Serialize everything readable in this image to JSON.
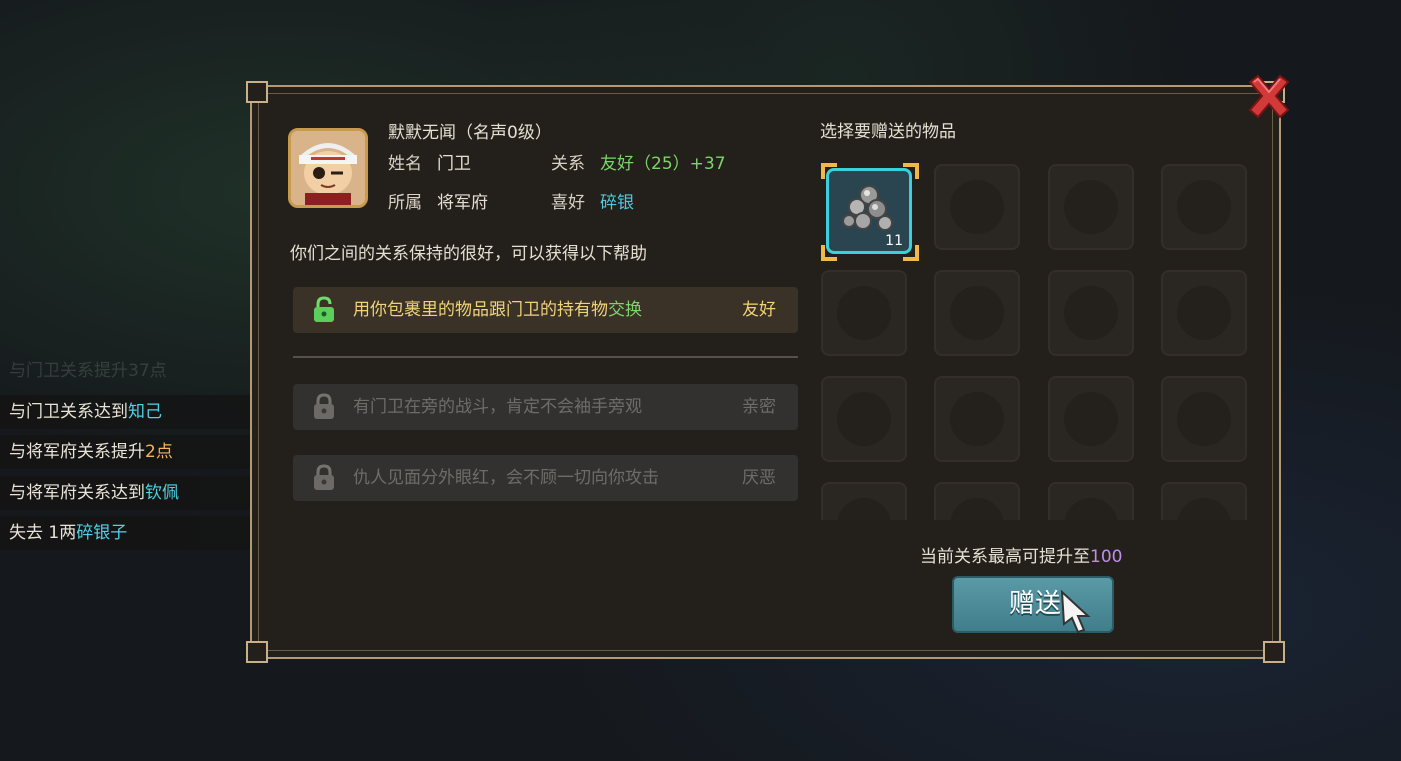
{
  "chat_log": [
    {
      "segments": [
        {
          "text": "与门卫关系提升37点",
          "color": ""
        }
      ],
      "faded": true
    },
    {
      "segments": [
        {
          "text": "与门卫关系达到",
          "color": ""
        },
        {
          "text": "知己",
          "color": "cyan"
        }
      ],
      "faded": false
    },
    {
      "segments": [
        {
          "text": "与将军府关系提升",
          "color": ""
        },
        {
          "text": "2点",
          "color": "orange"
        }
      ],
      "faded": false
    },
    {
      "segments": [
        {
          "text": "与将军府关系达到",
          "color": ""
        },
        {
          "text": "钦佩",
          "color": "cyan"
        }
      ],
      "faded": false
    },
    {
      "segments": [
        {
          "text": "失去 1两",
          "color": ""
        },
        {
          "text": "碎银子",
          "color": "cyan"
        }
      ],
      "faded": false
    }
  ],
  "npc": {
    "title": "默默无闻（名声0级）",
    "name_label": "姓名",
    "name": "门卫",
    "relation_label": "关系",
    "relation": "友好（25）+37",
    "faction_label": "所属",
    "faction": "将军府",
    "hobby_label": "喜好",
    "hobby": "碎银"
  },
  "help_intro": "你们之间的关系保持的很好，可以获得以下帮助",
  "help_options": [
    {
      "text_main": "用你包裹里的物品跟门卫的持有物",
      "text_accent": "交换",
      "level": "友好",
      "unlocked": true
    },
    {
      "text_main": "有门卫在旁的战斗，肯定不会袖手旁观",
      "text_accent": "",
      "level": "亲密",
      "unlocked": false
    },
    {
      "text_main": "仇人见面分外眼红，会不顾一切向你攻击",
      "text_accent": "",
      "level": "厌恶",
      "unlocked": false
    }
  ],
  "gift_panel": {
    "title": "选择要赠送的物品",
    "items": [
      {
        "icon": "silver-pieces-icon",
        "count": "11",
        "selected": true
      }
    ],
    "max_prefix": "当前关系最高可提升至",
    "max_value": "100",
    "give_label": "赠送"
  },
  "colors": {
    "accent_green": "#7bd66a",
    "accent_cyan": "#4fc9e0",
    "accent_gold": "#f0d27a",
    "accent_purple": "#c08ee8",
    "panel_border": "#b29a72"
  }
}
